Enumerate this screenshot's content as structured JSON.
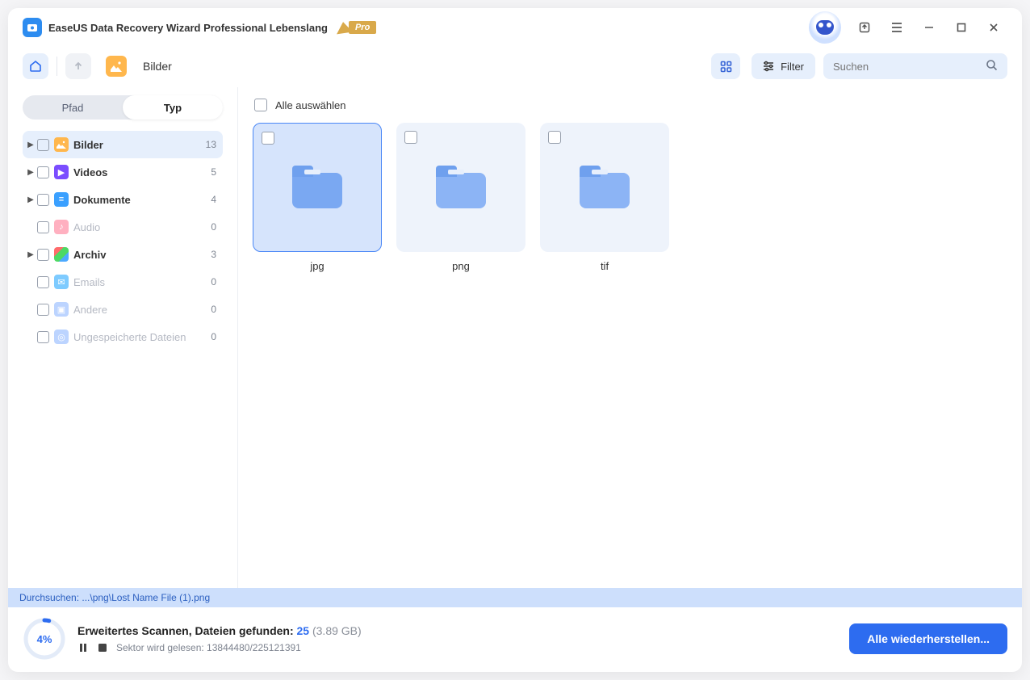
{
  "app": {
    "title": "EaseUS Data Recovery Wizard Professional Lebenslang",
    "pro": "Pro"
  },
  "toolbar": {
    "crumb": "Bilder",
    "filter": "Filter",
    "search_placeholder": "Suchen"
  },
  "sidebar": {
    "tab_path": "Pfad",
    "tab_type": "Typ",
    "items": [
      {
        "label": "Bilder",
        "count": "13"
      },
      {
        "label": "Videos",
        "count": "5"
      },
      {
        "label": "Dokumente",
        "count": "4"
      },
      {
        "label": "Audio",
        "count": "0"
      },
      {
        "label": "Archiv",
        "count": "3"
      },
      {
        "label": "Emails",
        "count": "0"
      },
      {
        "label": "Andere",
        "count": "0"
      },
      {
        "label": "Ungespeicherte Dateien",
        "count": "0"
      }
    ]
  },
  "main": {
    "select_all": "Alle auswählen",
    "folders": [
      {
        "name": "jpg"
      },
      {
        "name": "png"
      },
      {
        "name": "tif"
      }
    ]
  },
  "status": {
    "line": "Durchsuchen: ...\\png\\Lost Name File (1).png"
  },
  "footer": {
    "percent": "4%",
    "scan_label": "Erweitertes Scannen, Dateien gefunden: ",
    "found_count": "25",
    "found_size": " (3.89 GB)",
    "sector": "Sektor wird gelesen: 13844480/225121391",
    "recover": "Alle wiederherstellen..."
  }
}
